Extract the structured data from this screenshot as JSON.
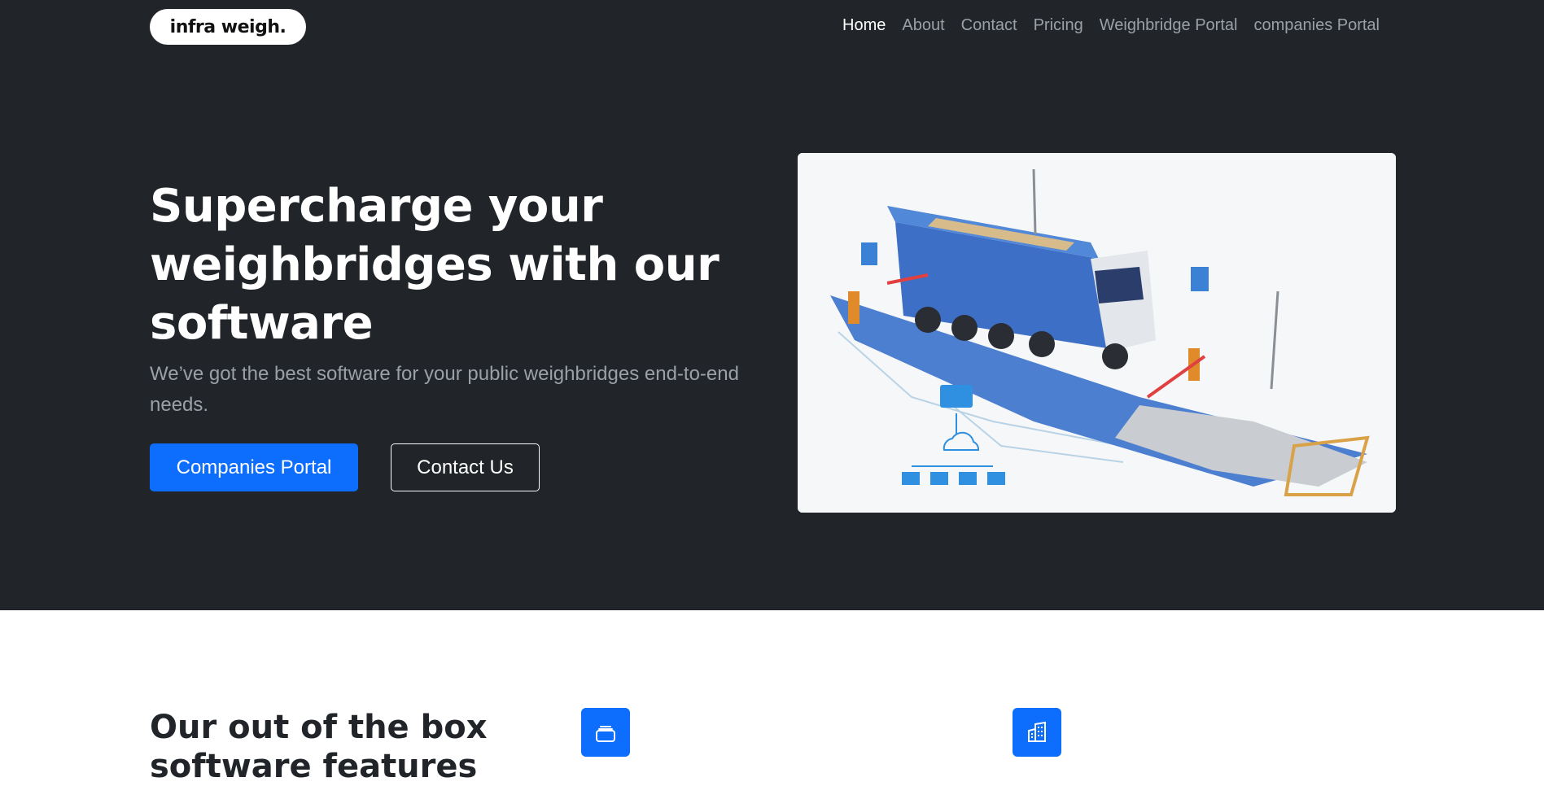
{
  "brand": {
    "logo_text": "infra weigh."
  },
  "nav": {
    "items": [
      {
        "label": "Home",
        "active": true
      },
      {
        "label": "About",
        "active": false
      },
      {
        "label": "Contact",
        "active": false
      },
      {
        "label": "Pricing",
        "active": false
      },
      {
        "label": "Weighbridge Portal",
        "active": false
      },
      {
        "label": "companies Portal",
        "active": false
      }
    ]
  },
  "hero": {
    "headline": "Supercharge your weighbridges with our software",
    "subtext": "We’ve got the best software for your public weighbridges end-to-end needs.",
    "primary_button": "Companies Portal",
    "secondary_button": "Contact Us",
    "image": "weighbridge-truck-illustration"
  },
  "features": {
    "title": "Our out of the box software features",
    "icons": [
      "collection-icon",
      "building-icon"
    ]
  },
  "colors": {
    "hero_bg": "#212529",
    "primary": "#0d6efd",
    "nav_muted": "#9aa0a6"
  }
}
